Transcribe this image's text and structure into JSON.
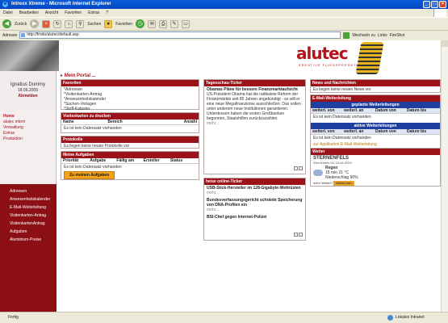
{
  "window": {
    "title": "Intrexx Xtreme - Microsoft Internet Explorer"
  },
  "menu": [
    "Datei",
    "Bearbeiten",
    "Ansicht",
    "Favoriten",
    "Extras",
    "?"
  ],
  "toolbar": {
    "back": "Zurück",
    "search": "Suchen",
    "favorites": "Favoriten"
  },
  "address": {
    "label": "Adresse",
    "url": "http://frodo/alutec/default.asp",
    "go": "Wechseln zu",
    "links": "Links",
    "extra": "FireShot"
  },
  "brand": {
    "logo": "alutec",
    "tagline": "KREATIVE FLIESSPRESSTECHNIK"
  },
  "user": {
    "name": "Ignatius Dummy",
    "date": "18.06.2009",
    "role": "Abmelden"
  },
  "nav_primary": [
    {
      "label": "Home",
      "active": true
    },
    {
      "label": "alutec intern",
      "active": false
    },
    {
      "label": "Verwaltung",
      "active": false
    },
    {
      "label": "Extras",
      "active": false
    },
    {
      "label": "Produktion",
      "active": false
    }
  ],
  "nav_secondary": [
    "Adressen",
    "Anwesenheitskalender",
    "E-Mail-Weiterleitung",
    "Visitenkarten-Antrag",
    "VisitenkartenAntrag",
    "Aufgaben",
    "Aluminium-Preise"
  ],
  "main": {
    "portal_title": "Mein Portal ..."
  },
  "favoriten": {
    "title": "Favoriten",
    "items": [
      "*Adressen",
      "*Visitenkarten-Antrag",
      "*Anwesenheitskalender",
      "*Suchen-Vorlagen",
      "*Stoff-Kataster"
    ]
  },
  "visitenkarten": {
    "title": "Visitenkarten zu drucken",
    "cols": [
      "Name",
      "Bereich",
      "Anzahl"
    ],
    "empty": "Es ist kein Datensatz vorhanden"
  },
  "protokolle": {
    "title": "Protokolle",
    "empty": "Es liegen keine neuen Protokolle vor"
  },
  "aufgaben": {
    "title": "Meine Aufgaben",
    "cols": [
      "Priorität",
      "Aufgabe",
      "Fällig am",
      "Ersteller",
      "Status"
    ],
    "empty": "Es ist kein Datensatz vorhanden",
    "button": "Zu meinen Aufgaben"
  },
  "tagesschau": {
    "title": "Tagesschau-Ticker",
    "headline": "Obamas Pläne für bessere Finanzmarktaufsicht",
    "body": "US-Präsident Obama hat die radikalste Reform der Finanzmärkte seit 80 Jahren angekündigt - so will er eine neue Megafinanzkrise ausschließen. Das sollen unter anderem neue Institutionen garantieren. Unterdessen haben die ersten Großbanken begonnen, Staatshilfen zurückzuzahlen.",
    "more": "mehr..."
  },
  "heise": {
    "title": "heise online-Ticker",
    "items": [
      {
        "title": "USB-Stick-Hersteller im 128-Gigabyte-Wettrüsten",
        "more": "mehr..."
      },
      {
        "title": "Bundesverfassungsgericht schränkt Speicherung von DNA-Profilen ein",
        "more": "mehr..."
      },
      {
        "title": "BSI-Chef gegen Internet-Polizei",
        "more": ""
      }
    ]
  },
  "news": {
    "title": "News und Nachrichten",
    "empty": "Es liegen keine neuen News vor"
  },
  "email": {
    "title": "E-Mail-Weiterleitung",
    "bar1": "geplante Weiterleitungen",
    "bar2": "aktive Weiterleitungen",
    "cols": [
      "weiterl. von",
      "weiterl. an",
      "Datum von",
      "Datum bis"
    ],
    "empty": "Es ist kein Datensatz vorhanden",
    "footer": "zur Applikation E-Mail-Weiterleitung"
  },
  "wetter": {
    "title": "Wetter",
    "station": "STERNENFELS",
    "date": "Sternenfels Do 18.06.2009",
    "condition": "Regen",
    "temps": "15 min 21 °C",
    "rain": "Niederschlag 90%",
    "link_label": "mehr Wetter?",
    "link_btn": "wetter.com"
  },
  "status": {
    "left": "Fertig",
    "zone": "Lokales Intranet"
  }
}
